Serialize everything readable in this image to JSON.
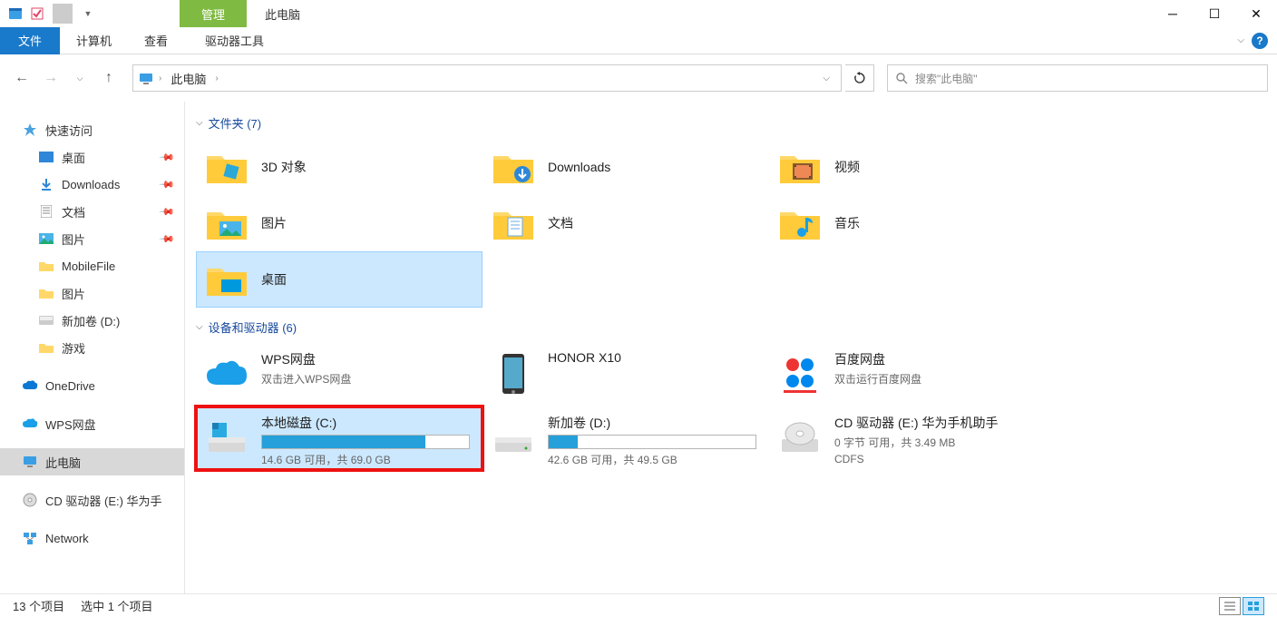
{
  "title": {
    "manage": "管理",
    "windowTitle": "此电脑"
  },
  "ribbon": {
    "file": "文件",
    "computer": "计算机",
    "view": "查看",
    "drivetools": "驱动器工具"
  },
  "address": {
    "root": "此电脑"
  },
  "search": {
    "placeholder": "搜索\"此电脑\""
  },
  "sidebar": {
    "quickaccess": "快速访问",
    "desktop": "桌面",
    "downloads": "Downloads",
    "documents": "文档",
    "pictures": "图片",
    "mobilefile": "MobileFile",
    "pictures2": "图片",
    "newvol": "新加卷 (D:)",
    "games": "游戏",
    "onedrive": "OneDrive",
    "wps": "WPS网盘",
    "thispc": "此电脑",
    "cddrive": "CD 驱动器 (E:) 华为手",
    "network": "Network"
  },
  "groups": {
    "folders": "文件夹 (7)",
    "devices": "设备和驱动器 (6)"
  },
  "folders": {
    "3dobjects": "3D 对象",
    "downloads": "Downloads",
    "videos": "视频",
    "pictures": "图片",
    "documents": "文档",
    "music": "音乐",
    "desktop": "桌面"
  },
  "drives": {
    "wps": {
      "name": "WPS网盘",
      "sub": "双击进入WPS网盘"
    },
    "honor": {
      "name": "HONOR X10"
    },
    "baidu": {
      "name": "百度网盘",
      "sub": "双击运行百度网盘"
    },
    "c": {
      "name": "本地磁盘 (C:)",
      "free": "14.6 GB 可用，共 69.0 GB",
      "fillPercent": 79
    },
    "d": {
      "name": "新加卷 (D:)",
      "free": "42.6 GB 可用，共 49.5 GB",
      "fillPercent": 14
    },
    "e": {
      "name": "CD 驱动器 (E:) 华为手机助手",
      "free": "0 字节 可用，共 3.49 MB",
      "fs": "CDFS"
    }
  },
  "status": {
    "items": "13 个项目",
    "selected": "选中 1 个项目"
  }
}
